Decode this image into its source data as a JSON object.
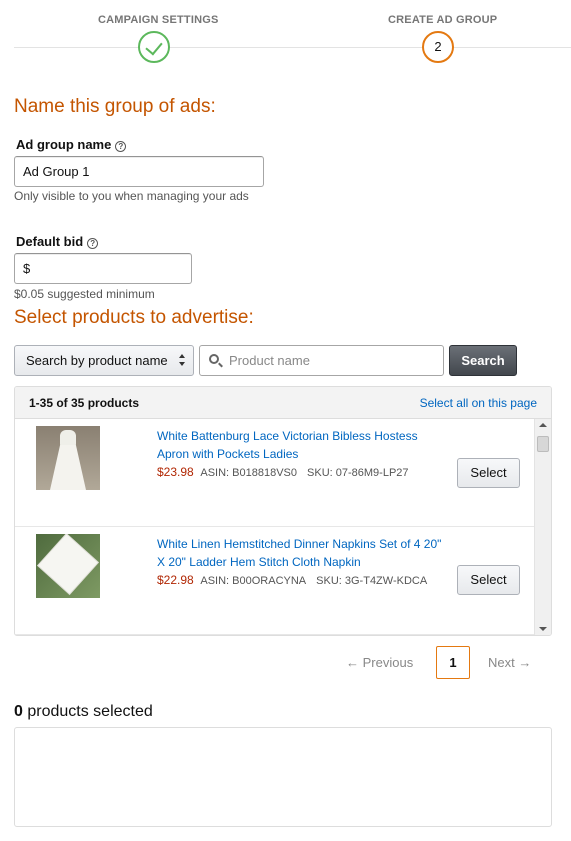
{
  "stepper": {
    "steps": [
      {
        "label": "CAMPAIGN SETTINGS",
        "status": "complete"
      },
      {
        "label": "CREATE AD GROUP",
        "number": "2",
        "status": "current"
      }
    ]
  },
  "ad_group": {
    "heading": "Name this group of ads:",
    "name_label": "Ad group name",
    "name_value": "Ad Group 1",
    "name_hint": "Only visible to you when managing your ads",
    "bid_label": "Default bid",
    "bid_value": "$",
    "bid_hint": "$0.05 suggested minimum",
    "help_glyph": "?"
  },
  "products": {
    "heading": "Select products to advertise:",
    "search_by": "Search by product name",
    "search_placeholder": "Product name",
    "search_button": "Search",
    "count_label": "1-35 of 35 products",
    "select_all": "Select all on this page",
    "items": [
      {
        "title": "White Battenburg Lace Victorian Bibless Hostess Apron with Pockets Ladies",
        "price": "$23.98",
        "asin": "ASIN: B018818VS0",
        "sku": "SKU: 07-86M9-LP27",
        "button": "Select",
        "image_icon": "white-dress-on-mannequin"
      },
      {
        "title": "White Linen Hemstitched Dinner Napkins Set of 4 20\" X 20\" Ladder Hem Stitch Cloth Napkin",
        "price": "$22.98",
        "asin": "ASIN: B00ORACYNA",
        "sku": "SKU: 3G-T4ZW-KDCA",
        "button": "Select",
        "image_icon": "folded-white-napkin"
      }
    ]
  },
  "pagination": {
    "prev": "← Previous",
    "page": "1",
    "next": "Next →"
  },
  "selected": {
    "count": "0",
    "label": " products selected"
  },
  "colors": {
    "accent_orange": "#c45500",
    "step_done_green": "#5cb85c",
    "step_current_orange": "#e47911",
    "link_blue": "#0066c0",
    "price_red": "#b12704"
  }
}
